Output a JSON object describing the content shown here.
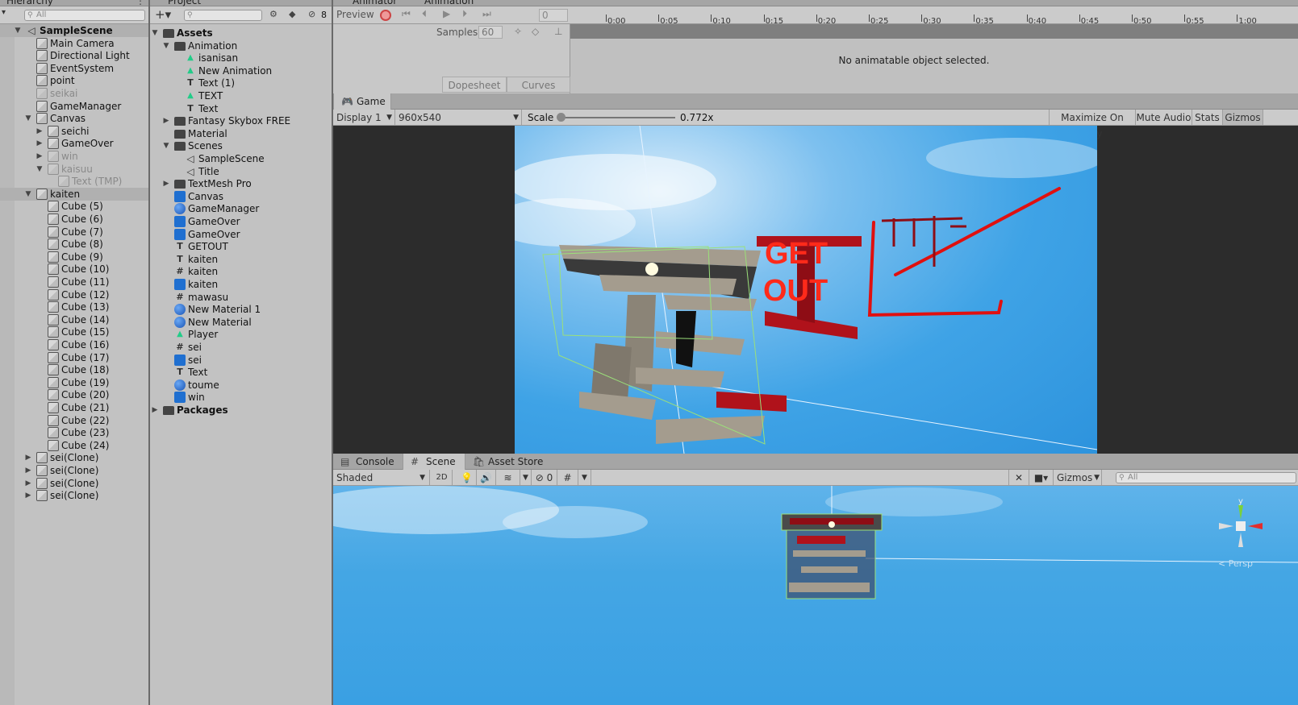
{
  "hierarchy": {
    "tab_title": "Hierarchy",
    "search_placeholder": "All",
    "items": [
      {
        "label": "SampleScene",
        "icon": "unity-scene-icon",
        "arrow": "▼",
        "bold": true
      },
      {
        "label": "Main Camera",
        "icon": "cube-icon"
      },
      {
        "label": "Directional Light",
        "icon": "cube-icon"
      },
      {
        "label": "EventSystem",
        "icon": "cube-icon"
      },
      {
        "label": "point",
        "icon": "cube-icon"
      },
      {
        "label": "seikai",
        "icon": "cube-icon",
        "dim": true
      },
      {
        "label": "GameManager",
        "icon": "cube-icon"
      },
      {
        "label": "Canvas",
        "icon": "cube-icon",
        "arrow": "▼"
      },
      {
        "label": "seichi",
        "icon": "cube-icon",
        "arrow": "▶"
      },
      {
        "label": "GameOver",
        "icon": "cube-icon",
        "arrow": "▶"
      },
      {
        "label": "win",
        "icon": "cube-icon",
        "arrow": "▶",
        "dim": true
      },
      {
        "label": "kaisuu",
        "icon": "cube-icon",
        "arrow": "▼",
        "dim": true
      },
      {
        "label": "Text (TMP)",
        "icon": "cube-icon",
        "dim": true
      },
      {
        "label": "kaiten",
        "icon": "cube-icon",
        "arrow": "▼"
      },
      {
        "label": "Cube (5)",
        "icon": "cube-icon"
      },
      {
        "label": "Cube (6)",
        "icon": "cube-icon"
      },
      {
        "label": "Cube (7)",
        "icon": "cube-icon"
      },
      {
        "label": "Cube (8)",
        "icon": "cube-icon"
      },
      {
        "label": "Cube (9)",
        "icon": "cube-icon"
      },
      {
        "label": "Cube (10)",
        "icon": "cube-icon"
      },
      {
        "label": "Cube (11)",
        "icon": "cube-icon"
      },
      {
        "label": "Cube (12)",
        "icon": "cube-icon"
      },
      {
        "label": "Cube (13)",
        "icon": "cube-icon"
      },
      {
        "label": "Cube (14)",
        "icon": "cube-icon"
      },
      {
        "label": "Cube (15)",
        "icon": "cube-icon"
      },
      {
        "label": "Cube (16)",
        "icon": "cube-icon"
      },
      {
        "label": "Cube (17)",
        "icon": "cube-icon"
      },
      {
        "label": "Cube (18)",
        "icon": "cube-icon"
      },
      {
        "label": "Cube (19)",
        "icon": "cube-icon"
      },
      {
        "label": "Cube (20)",
        "icon": "cube-icon"
      },
      {
        "label": "Cube (21)",
        "icon": "cube-icon"
      },
      {
        "label": "Cube (22)",
        "icon": "cube-icon"
      },
      {
        "label": "Cube (23)",
        "icon": "cube-icon"
      },
      {
        "label": "Cube (24)",
        "icon": "cube-icon"
      },
      {
        "label": "sei(Clone)",
        "icon": "cube-icon",
        "arrow": "▶"
      },
      {
        "label": "sei(Clone)",
        "icon": "cube-icon",
        "arrow": "▶"
      },
      {
        "label": "sei(Clone)",
        "icon": "cube-icon",
        "arrow": "▶"
      },
      {
        "label": "sei(Clone)",
        "icon": "cube-icon",
        "arrow": "▶"
      }
    ]
  },
  "project": {
    "tab_title": "Project",
    "hidden_count": "8",
    "items": [
      {
        "label": "Assets",
        "icon": "folder-icon",
        "arrow": "▼",
        "bold": true
      },
      {
        "label": "Animation",
        "icon": "folder-icon",
        "arrow": "▼"
      },
      {
        "label": "isanisan",
        "icon": "anim-icon"
      },
      {
        "label": "New Animation",
        "icon": "anim-icon"
      },
      {
        "label": "Text (1)",
        "icon": "text-icon"
      },
      {
        "label": "TEXT",
        "icon": "anim-icon"
      },
      {
        "label": "Text",
        "icon": "text-icon"
      },
      {
        "label": "Fantasy Skybox FREE",
        "icon": "folder-icon",
        "arrow": "▶"
      },
      {
        "label": "Material",
        "icon": "folder-icon"
      },
      {
        "label": "Scenes",
        "icon": "folder-icon",
        "arrow": "▼"
      },
      {
        "label": "SampleScene",
        "icon": "unity-scene-icon"
      },
      {
        "label": "Title",
        "icon": "unity-scene-icon"
      },
      {
        "label": "TextMesh Pro",
        "icon": "folder-icon",
        "arrow": "▶"
      },
      {
        "label": "Canvas",
        "icon": "prefab-icon"
      },
      {
        "label": "GameManager",
        "icon": "gear-asset-icon"
      },
      {
        "label": "GameOver",
        "icon": "prefab-icon"
      },
      {
        "label": "GameOver",
        "icon": "prefab-icon"
      },
      {
        "label": "GETOUT",
        "icon": "text-icon"
      },
      {
        "label": "kaiten",
        "icon": "text-icon"
      },
      {
        "label": "kaiten",
        "icon": "script-icon"
      },
      {
        "label": "kaiten",
        "icon": "prefab-icon"
      },
      {
        "label": "mawasu",
        "icon": "script-icon"
      },
      {
        "label": "New Material 1",
        "icon": "material-icon"
      },
      {
        "label": "New Material",
        "icon": "material-icon"
      },
      {
        "label": "Player",
        "icon": "anim-icon"
      },
      {
        "label": "sei",
        "icon": "script-icon"
      },
      {
        "label": "sei",
        "icon": "prefab-icon"
      },
      {
        "label": "Text",
        "icon": "text-icon"
      },
      {
        "label": "toume",
        "icon": "material-icon"
      },
      {
        "label": "win",
        "icon": "prefab-icon"
      },
      {
        "label": "Packages",
        "icon": "folder-icon",
        "arrow": "▶",
        "bold": true
      }
    ]
  },
  "animation": {
    "tabs": [
      "Animator",
      "Animation"
    ],
    "preview_label": "Preview",
    "frame_value": "0",
    "samples_label": "Samples",
    "samples_value": "60",
    "dopesheet_label": "Dopesheet",
    "curves_label": "Curves",
    "empty_message": "No animatable object selected.",
    "ruler_labels": [
      "0:00",
      "0:05",
      "0:10",
      "0:15",
      "0:20",
      "0:25",
      "0:30",
      "0:35",
      "0:40",
      "0:45",
      "0:50",
      "0:55",
      "1:00"
    ]
  },
  "game": {
    "tab_title": "Game",
    "display": "Display 1",
    "resolution": "960x540",
    "scale_label": "Scale",
    "scale_value": "0.772x",
    "buttons": [
      "Maximize On Play",
      "Mute Audio",
      "Stats",
      "Gizmos"
    ],
    "overlay_text_1": "GET",
    "overlay_text_2": "OUT"
  },
  "scene": {
    "tabs": [
      "Console",
      "Scene",
      "Asset Store"
    ],
    "shading": "Shaded",
    "mode_2d": "2D",
    "hidden_count": "0",
    "gizmos_label": "Gizmos",
    "search_placeholder": "All",
    "gizmo_y_label": "y",
    "persp_label": "< Persp"
  },
  "colors": {
    "accent_red": "#e01010",
    "sky_blue": "#3fa3e6",
    "wall_grey": "#a39b8c"
  }
}
